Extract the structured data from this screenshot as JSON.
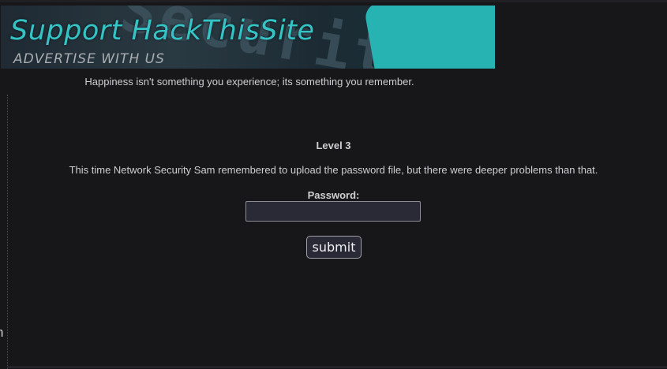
{
  "banner": {
    "title": "Support HackThisSite",
    "subtitle": "ADVERTISE WITH US",
    "background_text": "Security"
  },
  "quote": "Happiness isn't something you experience; its something you remember.",
  "challenge": {
    "level_title": "Level 3",
    "description": "This time Network Security Sam remembered to upload the password file, but there were deeper problems than that.",
    "password_label": "Password:",
    "password_value": "",
    "submit_label": "submit"
  },
  "edge_text": "n",
  "colors": {
    "background": "#171719",
    "banner_accent": "#35c4c6",
    "text": "#cfcfd3",
    "input_bg": "#2a2a36"
  }
}
